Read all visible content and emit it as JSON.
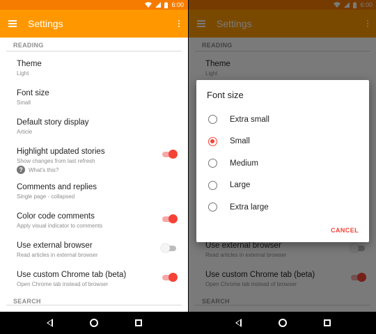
{
  "status": {
    "time": "6:00"
  },
  "toolbar": {
    "title": "Settings"
  },
  "sections": {
    "reading": "READING",
    "search": "SEARCH"
  },
  "settings": [
    {
      "title": "Theme",
      "summary": "Light",
      "toggle": null
    },
    {
      "title": "Font size",
      "summary": "Small",
      "toggle": null
    },
    {
      "title": "Default story display",
      "summary": "Article",
      "toggle": null
    },
    {
      "title": "Highlight updated stories",
      "summary": "Show changes from last refresh",
      "toggle": true
    },
    {
      "title": "Comments and replies",
      "summary": "Single page - collapsed",
      "toggle": null
    },
    {
      "title": "Color code comments",
      "summary": "Apply visual indicator to comments",
      "toggle": true
    },
    {
      "title": "Use external browser",
      "summary": "Read articles in external browser",
      "toggle": false
    },
    {
      "title": "Use custom Chrome tab (beta)",
      "summary": "Open Chrome tab instead of browser",
      "toggle": true
    }
  ],
  "help": {
    "text": "What's this?"
  },
  "dialog": {
    "title": "Font size",
    "options": [
      "Extra small",
      "Small",
      "Medium",
      "Large",
      "Extra large"
    ],
    "selected": "Small",
    "cancel_label": "CANCEL"
  },
  "colors": {
    "primary": "#ff9800",
    "primary_dark": "#f57c00",
    "accent": "#f44336"
  }
}
